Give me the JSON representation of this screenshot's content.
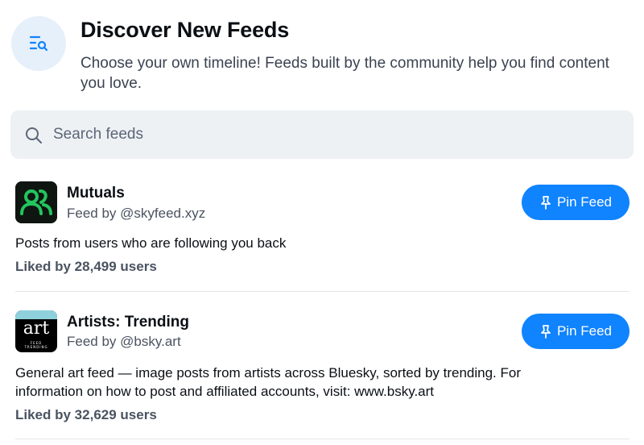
{
  "header": {
    "icon": "list-search-icon",
    "title": "Discover New Feeds",
    "subtitle": "Choose your own timeline! Feeds built by the community help you find content you love."
  },
  "search": {
    "placeholder": "Search feeds",
    "value": ""
  },
  "feeds": [
    {
      "name": "Mutuals",
      "by": "Feed by @skyfeed.xyz",
      "description": "Posts from users who are following you back",
      "likes": "Liked by 28,499 users",
      "pin_label": "Pin Feed",
      "avatar_icon": "users-icon",
      "avatar_color": "#1a9e4b"
    },
    {
      "name": "Artists: Trending",
      "by": "Feed by @bsky.art",
      "description": "General art feed — image posts from artists across Bluesky, sorted by trending. For information on how to post and affiliated accounts, visit: www.bsky.art",
      "likes": "Liked by 32,629 users",
      "pin_label": "Pin Feed",
      "avatar_text": "art",
      "avatar_small_1": "FEED",
      "avatar_small_2": "TRENDING"
    }
  ],
  "colors": {
    "accent": "#1083fe",
    "search_bg": "#eef1f4",
    "header_icon_bg": "#e6f0fb"
  }
}
